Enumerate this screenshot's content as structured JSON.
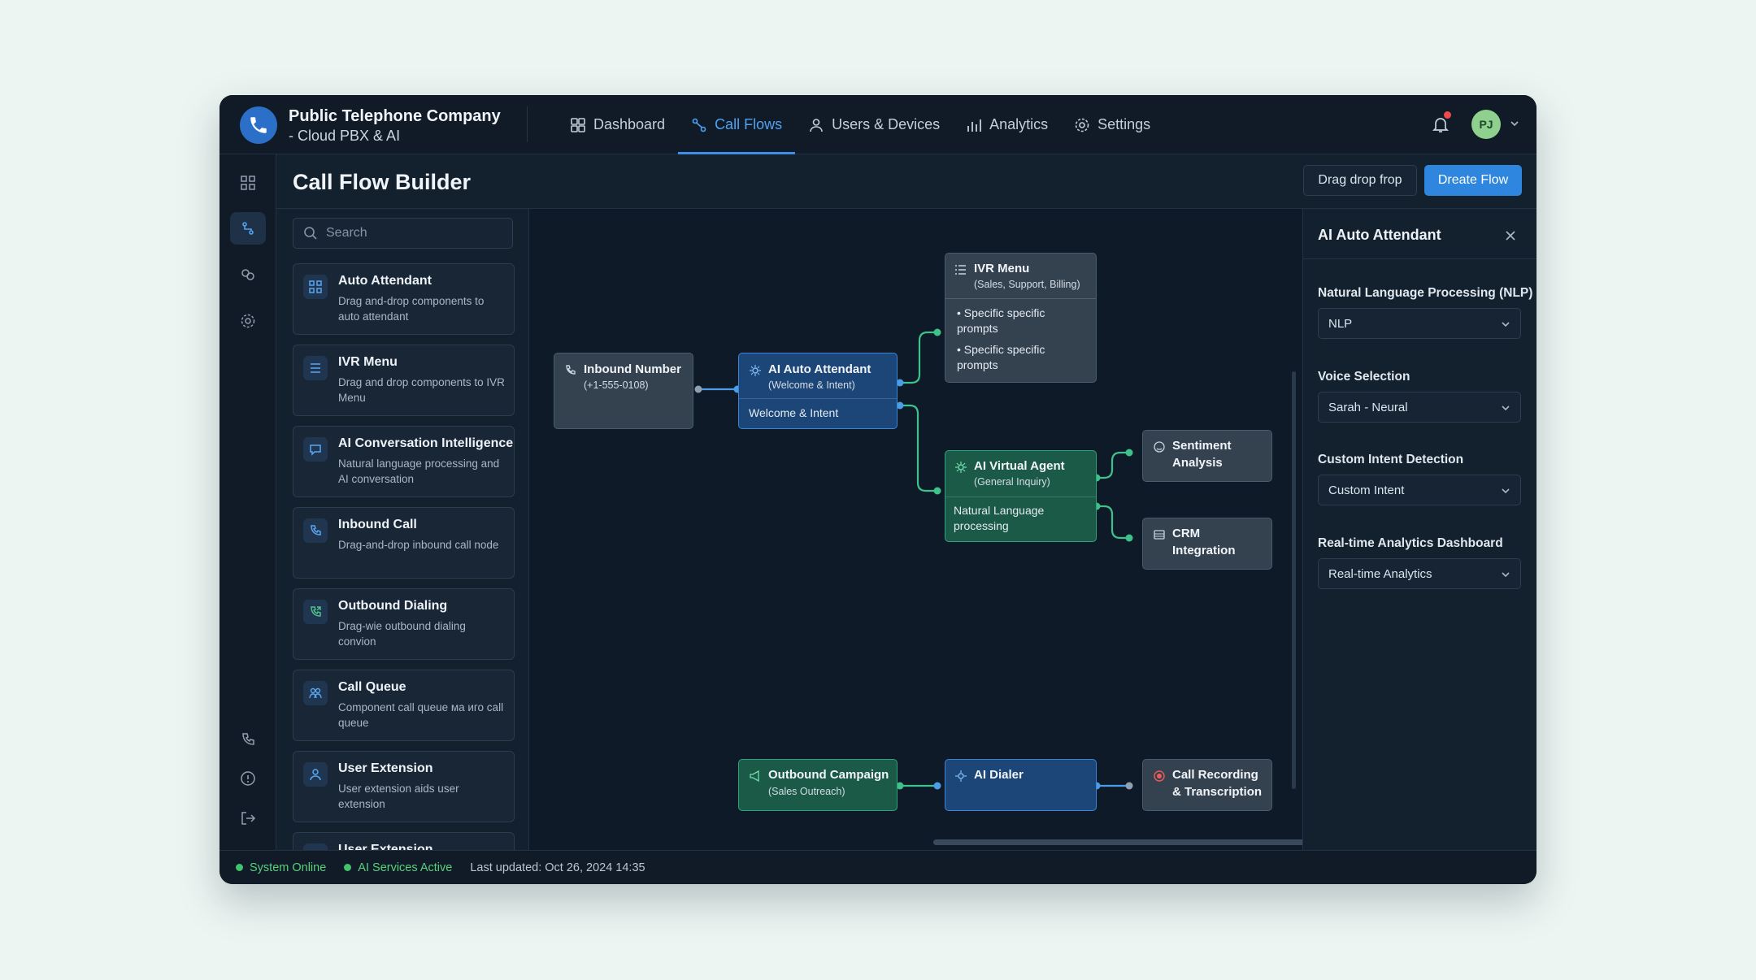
{
  "app": {
    "company_name": "Public Telephone Company",
    "product_name": "- Cloud PBX & AI"
  },
  "nav": {
    "items": [
      {
        "label": "Dashboard",
        "icon": "dashboard-icon",
        "active": false
      },
      {
        "label": "Call Flows",
        "icon": "call-flows-icon",
        "active": true
      },
      {
        "label": "Users & Devices",
        "icon": "users-icon",
        "active": false
      },
      {
        "label": "Analytics",
        "icon": "analytics-icon",
        "active": false
      },
      {
        "label": "Settings",
        "icon": "gear-icon",
        "active": false
      }
    ]
  },
  "user": {
    "initials": "PJ",
    "has_notification": true
  },
  "page": {
    "title": "Call Flow Builder",
    "secondary_button": "Drag drop frop",
    "primary_button": "Dreate Flow"
  },
  "palette": {
    "search_placeholder": "Search",
    "items": [
      {
        "title": "Auto Attendant",
        "desc": "Drag and-drop components to auto attendant",
        "icon": "auto-attendant-icon"
      },
      {
        "title": "IVR Menu",
        "desc": "Drag and drop components to IVR Menu",
        "icon": "list-icon"
      },
      {
        "title": "AI Conversation Intelligence",
        "desc": "Natural language processing and AI conversation",
        "icon": "chat-ai-icon"
      },
      {
        "title": "Inbound Call",
        "desc": "Drag-and-drop inbound call node",
        "icon": "phone-icon"
      },
      {
        "title": "Outbound Dialing",
        "desc": "Drag-wie outbound dialing convion",
        "icon": "phone-outgoing-icon"
      },
      {
        "title": "Call Queue",
        "desc": "Component call queue ма иго call queue",
        "icon": "queue-icon"
      },
      {
        "title": "User Extension",
        "desc": "User extension aids user extension",
        "icon": "user-icon"
      },
      {
        "title": "User Extension",
        "desc": "",
        "icon": "user-icon"
      }
    ]
  },
  "canvas": {
    "nodes": {
      "inbound": {
        "title": "Inbound Number",
        "subtitle": "(+1-555-0108)"
      },
      "auto_attendant": {
        "title": "AI Auto Attendant",
        "subtitle": "(Welcome & Intent)",
        "body": "Welcome & Intent"
      },
      "ivr": {
        "title": "IVR Menu",
        "subtitle": "(Sales, Support, Billing)",
        "bullets": [
          "Specific specific prompts",
          "Specific specific prompts"
        ]
      },
      "virtual_agent": {
        "title": "AI Virtual Agent",
        "subtitle": "(General Inquiry)",
        "body": "Natural Language processing"
      },
      "sentiment": {
        "title": "Sentiment",
        "title2": "Analysis"
      },
      "crm": {
        "title": "CRM",
        "title2": "Integration"
      },
      "outbound": {
        "title": "Outbound Campaign",
        "subtitle": "(Sales Outreach)"
      },
      "dialer": {
        "title": "AI Dialer"
      },
      "recording": {
        "title": "Call Recording",
        "title2": "& Transcription"
      }
    }
  },
  "properties": {
    "title": "AI Auto Attendant",
    "fields": [
      {
        "label": "Natural Language Processing (NLP)",
        "value": "NLP"
      },
      {
        "label": "Voice Selection",
        "value": "Sarah - Neural"
      },
      {
        "label": "Custom Intent Detection",
        "value": "Custom Intent"
      },
      {
        "label": "Real-time Analytics Dashboard",
        "value": "Real-time Analytics"
      }
    ]
  },
  "status": {
    "system": "System Online",
    "ai": "AI Services Active",
    "updated": "Last updated: Oct 26, 2024 14:35"
  },
  "colors": {
    "accent": "#2f86de",
    "online": "#3fc46b",
    "node_blue": "#1c4677",
    "node_green": "#1b5a47",
    "node_gray": "#34414f"
  }
}
